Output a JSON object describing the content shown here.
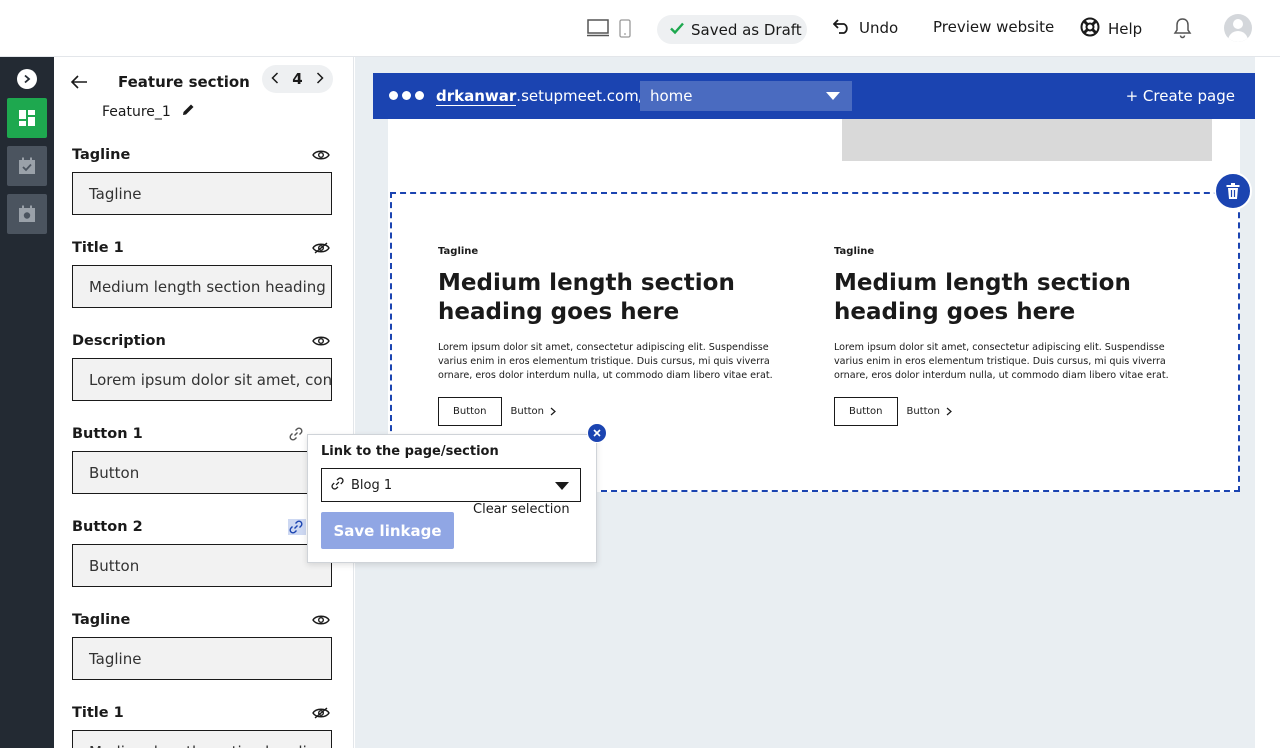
{
  "topbar": {
    "saved_label": "Saved as Draft",
    "undo_label": "Undo",
    "preview_label": "Preview website",
    "help_label": "Help",
    "icons": [
      "desktop-icon",
      "mobile-icon",
      "check-icon",
      "undo-icon",
      "help-icon",
      "bell-icon",
      "avatar"
    ]
  },
  "rail": {
    "items": [
      "expand-icon",
      "layout-icon",
      "calendar-icon",
      "camera-icon"
    ],
    "active_color": "#1ea84f"
  },
  "panel": {
    "title": "Feature section",
    "page_number": "4",
    "subtitle": "Feature_1",
    "fields": [
      {
        "label": "Tagline",
        "value": "Tagline",
        "icon": "eye-icon"
      },
      {
        "label": "Title 1",
        "value": "Medium length section heading",
        "icon": "eye-off-icon"
      },
      {
        "label": "Description",
        "value": "Lorem ipsum dolor sit amet, con",
        "icon": "eye-icon"
      },
      {
        "label": "Button 1",
        "value": "Button",
        "icon": "link-icon"
      },
      {
        "label": "Button 2",
        "value": "Button",
        "icon": "link-icon"
      },
      {
        "label": "Tagline",
        "value": "Tagline",
        "icon": "eye-icon"
      },
      {
        "label": "Title 1",
        "value": "Medium length section heading",
        "icon": "eye-off-icon"
      }
    ]
  },
  "browser": {
    "domain_bold": "drkanwar",
    "domain_rest": ".setupmeet.com/",
    "page": "home",
    "create_page": "+ Create page",
    "accent": "#1b44b1"
  },
  "features": [
    {
      "tagline": "Tagline",
      "heading": "Medium length section heading goes here",
      "description": "Lorem ipsum dolor sit amet, consectetur adipiscing elit. Suspendisse varius enim in eros elementum tristique. Duis cursus, mi quis viverra ornare, eros dolor interdum nulla, ut commodo diam libero vitae erat.",
      "button1": "Button",
      "button2": "Button"
    },
    {
      "tagline": "Tagline",
      "heading": "Medium length section heading goes here",
      "description": "Lorem ipsum dolor sit amet, consectetur adipiscing elit. Suspendisse varius enim in eros elementum tristique. Duis cursus, mi quis viverra ornare, eros dolor interdum nulla, ut commodo diam libero vitae erat.",
      "button1": "Button",
      "button2": "Button"
    }
  ],
  "popover": {
    "title": "Link to the page/section",
    "selected": "Blog 1",
    "save_label": "Save linkage",
    "clear_label": "Clear selection"
  }
}
